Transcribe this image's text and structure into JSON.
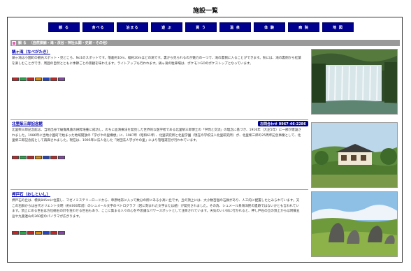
{
  "page": {
    "title": "施設一覧"
  },
  "nav": [
    {
      "label": "観 る"
    },
    {
      "label": "食べる"
    },
    {
      "label": "泊まる"
    },
    {
      "label": "遊 ぶ"
    },
    {
      "label": "買 う"
    },
    {
      "label": "温 泉"
    },
    {
      "label": "体 験"
    },
    {
      "label": "病 院"
    },
    {
      "label": "地 図"
    }
  ],
  "section": {
    "title": "観 る",
    "subtitle": "（自然景観・滝・渓谷・神社仏閣・史跡・その他）"
  },
  "entries": [
    {
      "title": "鍋ヶ滝（なべがたき）",
      "text": "鍋ヶ滝は小国町の観光スポット・見どころ、No1のスポットです。落差約10m、幅約20mほどの滝です。裏から見られるのが魅力の一つで、滝の裏側に入ることができます。秋には、滝の裏側から紅葉を楽しむことができ、周囲の自然とともに季節ごとの景観を味わえます。ライトアップも行われます。鍋ヶ滝の駐車場は、ポケモンGOのポケストップとなっています。",
      "tags": [
        "マップ",
        "トイレ",
        "駐車",
        "写真",
        "周辺",
        "案内",
        "地図"
      ]
    },
    {
      "title": "北里柴三郎記念館",
      "phone": "お問合わせ 0967-46-2286",
      "text": "北里柴三郎記念館は、当地出身で破傷風菌の純粋培養に成功し、のちに血清療法を発見した世界的な医学者である北里柴三郎博士の「学問と交流」の理念に基づき、1916年（大正5年）に一部が建設されました。1986年に当地小国町で始まった地域開放の「学びやの里構想」に、1987年（昭和61年）、北里研究所と北里学園（現在の学校法人北里研究所）が、北里柴三郎の25周年記念事業として、北里柴三郎記念館として再興されました。現在は、1995年に法人化した「財団法人学びやの里」により管理運営が行われています。",
      "tags": [
        "マップ",
        "トイレ",
        "駐車",
        "写真",
        "周辺",
        "案内",
        "地図"
      ]
    },
    {
      "title": "押戸石（おしといし）",
      "text": "押戸石の丘は、標高845mに位置し、マゼノミステリーロードから、草原地帯に入って数分の所にある小高い丘です。丘の頂上には、大小数百個の石群があり、人工的に配置したとみられています。又この石群からは古代オリエント文明（約4000年前）のシュメール文字のペトログラフ（岩に刻まれた文字または絵）が発見されました。その為、シュメール系海洋民の遺跡ではないかとも言われています。頂上にある巨石は方位磁石の針を狂わせる巨石もあり、ここに集まる人々の心を不思議なパワースポットとして注目されています。天気のいい日に行かれると、押し戸石の丘の頂上からは阿蘇五岳や九重連山の360度のパノラマが広がります。",
      "tags": [
        "マップ",
        "トイレ",
        "駐車",
        "写真",
        "周辺",
        "案内",
        "地図"
      ]
    }
  ],
  "colors": {
    "nav_bg": "#00008e",
    "section_bar": "#9a9a9a",
    "link": "#0000aa",
    "tags": [
      "#cc2222",
      "#22aa44",
      "#cc2222",
      "#dd8800",
      "#2244cc",
      "#cc2222",
      "#8844aa"
    ]
  }
}
